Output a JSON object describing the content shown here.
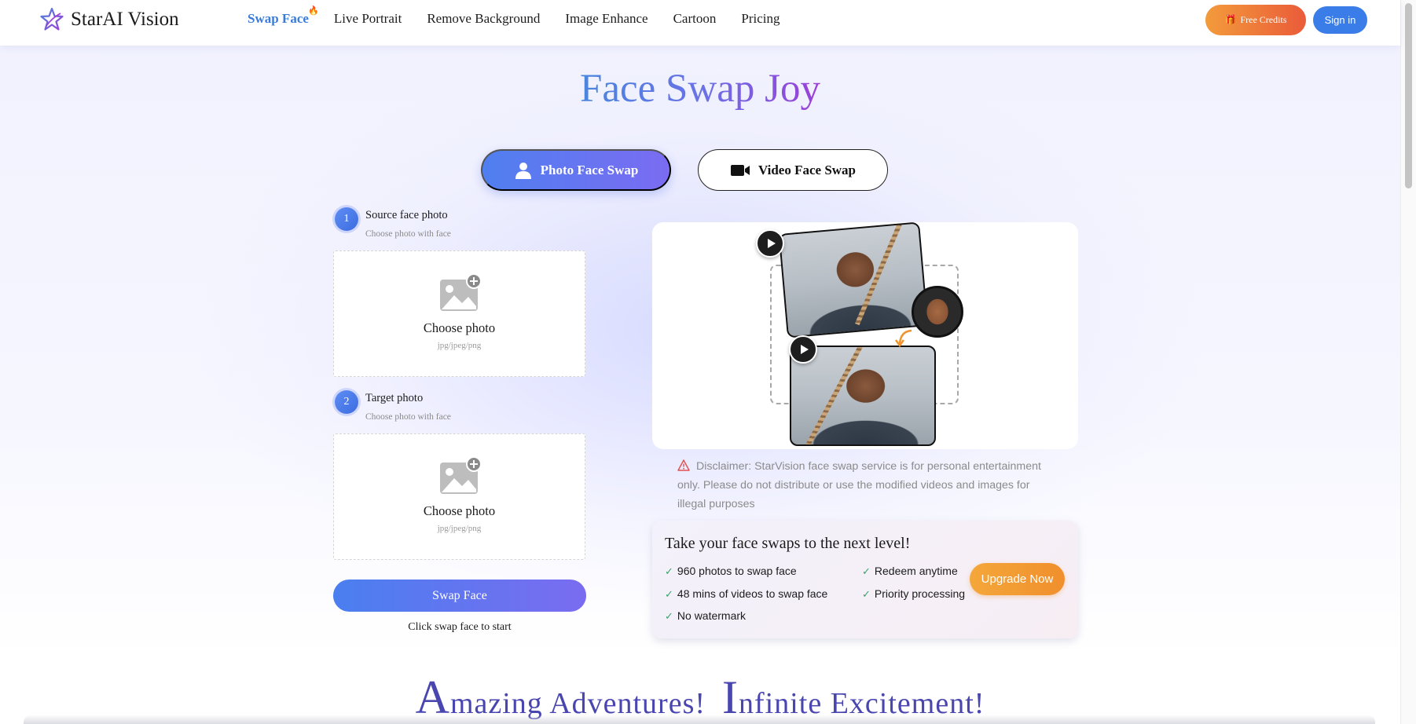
{
  "app": {
    "logo_text": "StarAI Vision"
  },
  "nav": {
    "items": [
      {
        "label": "Swap Face"
      },
      {
        "label": "Live Portrait"
      },
      {
        "label": "Remove Background"
      },
      {
        "label": "Image Enhance"
      },
      {
        "label": "Cartoon"
      },
      {
        "label": "Pricing"
      }
    ],
    "active_index": 0,
    "active_badge": "fire-icon"
  },
  "header": {
    "free_credits_label": "Free Credits",
    "sign_in_label": "Sign in"
  },
  "hero": {
    "title": "Face Swap Joy"
  },
  "tabs": {
    "photo_label": "Photo Face Swap",
    "video_label": "Video Face Swap",
    "active": "photo"
  },
  "steps": [
    {
      "number": "1",
      "title": "Source face photo",
      "subtitle": "Choose photo with face",
      "upload_label": "Choose photo",
      "upload_hint": "jpg/jpeg/png"
    },
    {
      "number": "2",
      "title": "Target photo",
      "subtitle": "Choose photo with face",
      "upload_label": "Choose photo",
      "upload_hint": "jpg/jpeg/png"
    }
  ],
  "swap": {
    "button_label": "Swap Face",
    "hint": "Click swap face to start"
  },
  "disclaimer": {
    "text": "Disclaimer: StarVision face swap service is for personal entertainment only. Please do not distribute or use the modified videos and images for illegal purposes"
  },
  "upgrade": {
    "title": "Take your face swaps to the next level!",
    "features": [
      "960 photos to swap face",
      "Redeem anytime",
      "48 mins of videos to swap face",
      "Priority processing",
      "No watermark"
    ],
    "button_label": "Upgrade Now"
  },
  "bottom": {
    "heading_part1_initial": "A",
    "heading_part1_rest": "mazing Adventures!",
    "heading_part2_initial": "I",
    "heading_part2_rest": "nfinite Excitement!"
  },
  "colors": {
    "primary": "#3a7de8",
    "gradient_start": "#4a7ff0",
    "gradient_end": "#7a6cf0",
    "accent_orange": "#f08f2d",
    "check_green": "#3aa26b",
    "warning_red": "#e05050"
  }
}
